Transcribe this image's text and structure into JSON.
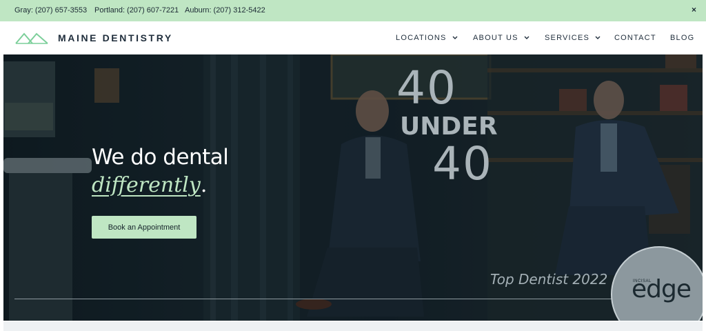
{
  "topbar": {
    "phones": [
      {
        "city": "Gray:",
        "number": "(207) 657-3553"
      },
      {
        "city": "Portland:",
        "number": "(207) 607-7221"
      },
      {
        "city": "Auburn:",
        "number": "(207) 312-5422"
      }
    ],
    "close_label": "×"
  },
  "header": {
    "logo_text": "MAINE DENTISTRY",
    "nav": [
      {
        "label": "LOCATIONS",
        "has_dropdown": true
      },
      {
        "label": "ABOUT US",
        "has_dropdown": true
      },
      {
        "label": "SERVICES",
        "has_dropdown": true
      },
      {
        "label": "CONTACT",
        "has_dropdown": false
      },
      {
        "label": "BLOG",
        "has_dropdown": false
      }
    ]
  },
  "hero": {
    "headline_line1": "We do dental",
    "headline_word": "differently",
    "headline_period": ".",
    "cta_label": "Book an Appointment",
    "award_top": "40",
    "award_middle": "UNDER",
    "award_bottom": "40",
    "award_caption": "Top Dentist 2022",
    "badge_small": "INCISAL",
    "badge_big": "edge"
  },
  "colors": {
    "accent_mint": "#bfe6c3",
    "navy_text": "#1f2d3b",
    "hero_dark": "#15232a"
  }
}
